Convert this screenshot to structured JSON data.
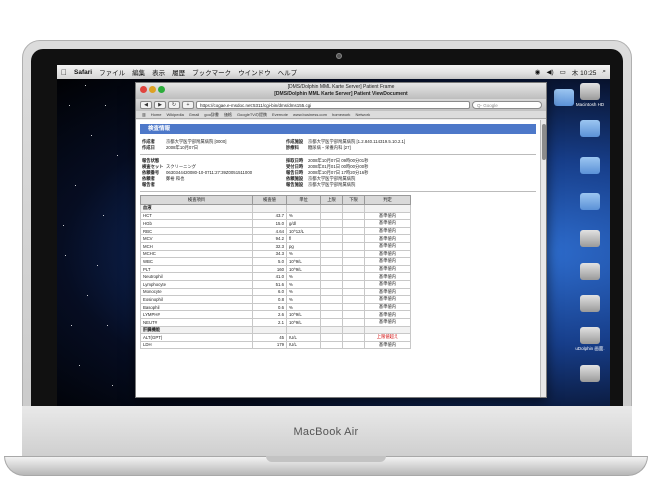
{
  "menubar": {
    "app": "Safari",
    "items": [
      "ファイル",
      "編集",
      "表示",
      "履歴",
      "ブックマーク",
      "ウインドウ",
      "ヘルプ"
    ],
    "clock": "木 10:25"
  },
  "window": {
    "title_top": "[DMS/Dolphin MML Karte Server] Patient Frame",
    "title_main": "[DMS/Dolphin MML Karte Server] Patient ViewDocument",
    "url": "https://cogae.e-msdoc.net:5311/cgi-bin/dms/dms155.cgi",
    "search_placeholder": "Q- Google",
    "bookmarks": [
      "Home",
      "Wikipedia",
      "Gmail",
      "goo辞書",
      "価格",
      "GoogleTVの提携",
      "Evernote",
      "www.business.com",
      "homework",
      "Network"
    ]
  },
  "report": {
    "header": "検査情報",
    "rows_top": [
      {
        "k": "作成者",
        "v": "京都大学医学部附属病院 [0000]",
        "k2": "作成施設",
        "v2": "京都大学医学部附属病院 [1.2.840.114319.5.10.2.1]"
      },
      {
        "k": "作成日",
        "v": "2008年10月07日",
        "k2": "診療科",
        "v2": "糖尿病・栄養内科 [27]"
      }
    ],
    "rows_mid": [
      {
        "k": "報告状態",
        "v": "",
        "k2": "採取日時",
        "v2": "2008年10月07日 09時00分01秒"
      },
      {
        "k": "検査セット",
        "v": "スクリーニング",
        "k2": "受付日時",
        "v2": "2008年01月01日 00時00分00秒"
      },
      {
        "k": "依頼番号",
        "v": "0630344420080-10-0711:27:39Z0051511000",
        "k2": "報告日時",
        "v2": "2008年10月07日 17時20分16秒"
      },
      {
        "k": "依頼者",
        "v": "鄭裕 和也",
        "k2": "依頼施設",
        "v2": "京都大学医学部附属病院"
      },
      {
        "k": "報告者",
        "v": "",
        "k2": "報告施設",
        "v2": "京都大学医学部附属病院"
      }
    ]
  },
  "table": {
    "headers": [
      "検査項目",
      "検査値",
      "単位",
      "上限",
      "下限",
      "判定"
    ],
    "rows": [
      {
        "name": "血液",
        "val": "",
        "unit": "",
        "hi": "",
        "lo": "",
        "judge": "",
        "group": true
      },
      {
        "name": "HCT",
        "val": "43.7",
        "unit": "%",
        "hi": "",
        "lo": "",
        "judge": "基準値内"
      },
      {
        "name": "HGb",
        "val": "15.0",
        "unit": "g/dl",
        "hi": "",
        "lo": "",
        "judge": "基準値内"
      },
      {
        "name": "RBC",
        "val": "4.64",
        "unit": "10^12/L",
        "hi": "",
        "lo": "",
        "judge": "基準値内"
      },
      {
        "name": "MCV",
        "val": "94.2",
        "unit": "fl",
        "hi": "",
        "lo": "",
        "judge": "基準値内"
      },
      {
        "name": "MCH",
        "val": "32.3",
        "unit": "pg",
        "hi": "",
        "lo": "",
        "judge": "基準値内"
      },
      {
        "name": "MCHC",
        "val": "34.3",
        "unit": "%",
        "hi": "",
        "lo": "",
        "judge": "基準値内"
      },
      {
        "name": "WBC",
        "val": "5.0",
        "unit": "10^9/L",
        "hi": "",
        "lo": "",
        "judge": "基準値内"
      },
      {
        "name": "PLT",
        "val": "160",
        "unit": "10^9/L",
        "hi": "",
        "lo": "",
        "judge": "基準値内"
      },
      {
        "name": "Neutrophil",
        "val": "41.0",
        "unit": "%",
        "hi": "",
        "lo": "",
        "judge": "基準値内"
      },
      {
        "name": "Lymphocyte",
        "val": "51.6",
        "unit": "%",
        "hi": "",
        "lo": "",
        "judge": "基準値内"
      },
      {
        "name": "Monocyte",
        "val": "6.0",
        "unit": "%",
        "hi": "",
        "lo": "",
        "judge": "基準値内"
      },
      {
        "name": "Eosinophil",
        "val": "0.8",
        "unit": "%",
        "hi": "",
        "lo": "",
        "judge": "基準値内"
      },
      {
        "name": "Basophil",
        "val": "0.6",
        "unit": "%",
        "hi": "",
        "lo": "",
        "judge": "基準値内"
      },
      {
        "name": "LYMPH#",
        "val": "2.6",
        "unit": "10^9/L",
        "hi": "",
        "lo": "",
        "judge": "基準値内"
      },
      {
        "name": "NEUT#",
        "val": "2.1",
        "unit": "10^9/L",
        "hi": "",
        "lo": "",
        "judge": "基準値内"
      },
      {
        "name": "肝臓機能",
        "val": "",
        "unit": "",
        "hi": "",
        "lo": "",
        "judge": "",
        "group": true
      },
      {
        "name": "ALT(GPT)",
        "val": "45",
        "unit": "IU/L",
        "hi": "",
        "lo": "",
        "judge": "上限値超え",
        "alert": true
      },
      {
        "name": "LDH",
        "val": "179",
        "unit": "IU/L",
        "hi": "",
        "lo": "",
        "judge": "基準値内"
      }
    ]
  },
  "desktop_icons": [
    {
      "label": "Macintosh HD",
      "kind": "drive"
    },
    {
      "label": "",
      "kind": "folder"
    },
    {
      "label": "",
      "kind": "folder"
    },
    {
      "label": "",
      "kind": "folder"
    },
    {
      "label": "",
      "kind": "folder"
    },
    {
      "label": "",
      "kind": "doc"
    },
    {
      "label": "",
      "kind": "doc"
    },
    {
      "label": "",
      "kind": "doc"
    },
    {
      "label": "uDolphin 画面.",
      "kind": "doc"
    },
    {
      "label": "",
      "kind": "doc"
    }
  ],
  "laptop": {
    "brand": "MacBook Air"
  },
  "colors": {
    "header_blue": "#4d78c9",
    "alert_red": "#d00000"
  }
}
